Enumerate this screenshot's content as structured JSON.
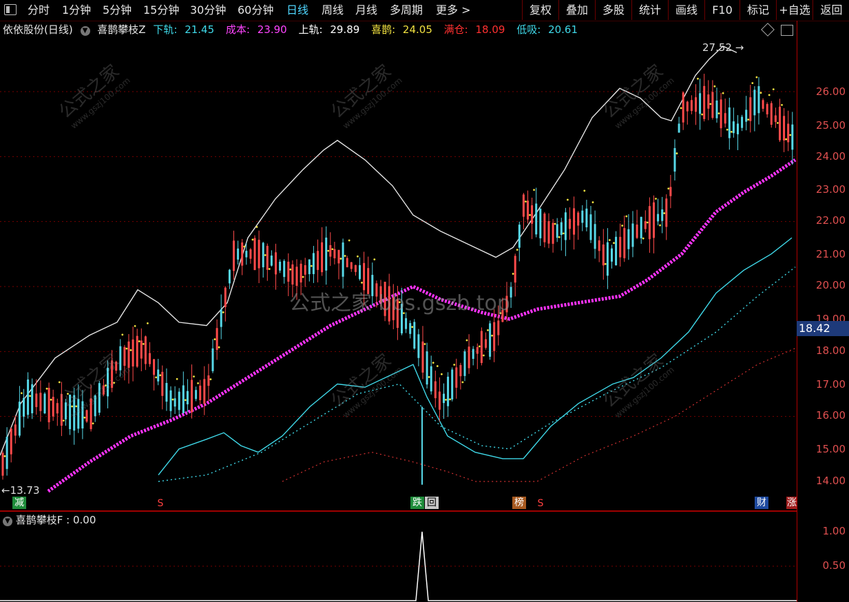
{
  "toolbar": {
    "items": [
      "分时",
      "1分钟",
      "5分钟",
      "15分钟",
      "30分钟",
      "60分钟",
      "日线",
      "周线",
      "月线",
      "多周期",
      "更多 >"
    ],
    "active": "日线",
    "right_items": [
      "复权",
      "叠加",
      "多股",
      "统计",
      "画线",
      "F10",
      "标记",
      "+自选",
      "返回"
    ]
  },
  "legend": {
    "stock": "依依股份(日线)",
    "indicator": "喜鹊攀枝Z",
    "lower_label": "下轨:",
    "lower_value": "21.45",
    "cost_label": "成本:",
    "cost_value": "23.90",
    "upper_label": "上轨:",
    "upper_value": "29.89",
    "xique_label": "喜鹊:",
    "xique_value": "24.05",
    "full_label": "满仓:",
    "full_value": "18.09",
    "low_label": "低吸:",
    "low_value": "20.61",
    "colors": {
      "lower": "#3fd8e8",
      "cost": "#ff44ff",
      "upper": "#ffffff",
      "xique": "#f0e040",
      "full": "#ff3030",
      "low": "#3fd8e8"
    }
  },
  "y_axis": {
    "ticks": [
      "26.00",
      "25.00",
      "24.00",
      "23.00",
      "22.00",
      "21.00",
      "20.00",
      "19.00",
      "18.00",
      "17.00",
      "16.00",
      "15.00",
      "14.00"
    ],
    "current_price": "18.42"
  },
  "annotations": {
    "high": "27.52",
    "low": "13.73",
    "watermark_center": "公式之家 bbs.gszb.top",
    "watermark_logo": "公式之家",
    "watermark_url": "www.gszj100.com"
  },
  "markers": {
    "jian": "减",
    "s1": "S",
    "die": "跌",
    "hui": "回",
    "bang": "榜",
    "s2": "S",
    "cai": "财",
    "zhang": "涨"
  },
  "sub_panel": {
    "label": "喜鹊攀枝F : 0.00",
    "ticks": [
      "1.00",
      "0.50"
    ]
  }
}
